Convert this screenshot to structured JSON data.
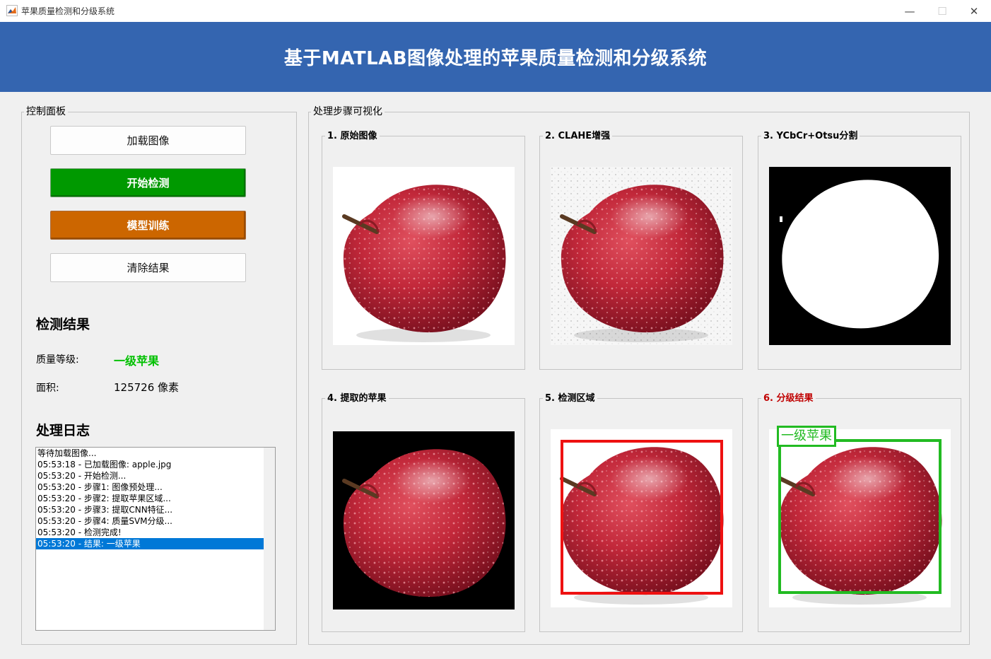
{
  "window": {
    "title": "苹果质量检测和分级系统",
    "minimize_glyph": "—",
    "maximize_glyph": "☐",
    "close_glyph": "✕"
  },
  "header": {
    "title": "基于MATLAB图像处理的苹果质量检测和分级系统"
  },
  "control_panel": {
    "label": "控制面板",
    "buttons": {
      "load": "加载图像",
      "start": "开始检测",
      "train": "模型训练",
      "clear": "清除结果"
    },
    "results": {
      "heading": "检测结果",
      "grade_label": "质量等级:",
      "grade_value": "一级苹果",
      "area_label": "面积:",
      "area_value": "125726 像素"
    },
    "log": {
      "heading": "处理日志",
      "items": [
        "等待加载图像...",
        "05:53:18 - 已加载图像: apple.jpg",
        "05:53:20 - 开始检测...",
        "05:53:20 - 步骤1: 图像预处理...",
        "05:53:20 - 步骤2: 提取苹果区域...",
        "05:53:20 - 步骤3: 提取CNN特征...",
        "05:53:20 - 步骤4: 质量SVM分级...",
        "05:53:20 - 检测完成!",
        "05:53:20 - 结果: 一级苹果"
      ],
      "selected_index": 8
    }
  },
  "visualization": {
    "label": "处理步骤可视化",
    "steps": [
      {
        "label": "1. 原始图像"
      },
      {
        "label": "2. CLAHE增强"
      },
      {
        "label": "3. YCbCr+Otsu分割"
      },
      {
        "label": "4. 提取的苹果"
      },
      {
        "label": "5. 检测区域"
      },
      {
        "label": "6. 分级结果"
      }
    ],
    "grade_overlay_text": "一级苹果"
  },
  "colors": {
    "header_bg": "#3465b0",
    "start_button": "#009900",
    "train_button": "#cc6600",
    "grade_text": "#00c000",
    "detection_box": "#ee1111",
    "grade_box": "#22bb22",
    "step6_label": "#c00000",
    "selection": "#0078d7"
  },
  "icons": {
    "app": "matlab-icon",
    "minimize": "minimize-icon",
    "maximize": "maximize-icon",
    "close": "close-icon"
  }
}
